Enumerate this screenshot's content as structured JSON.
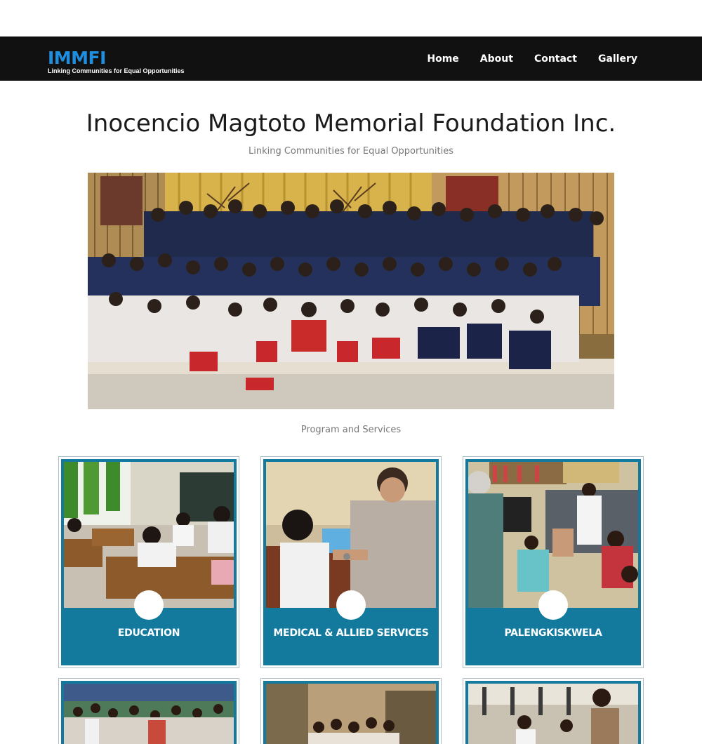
{
  "nav": {
    "brand_name": "IMMFI",
    "brand_tagline": "Linking Communities for Equal Opportunities",
    "links": [
      "Home",
      "About",
      "Contact",
      "Gallery"
    ]
  },
  "hero": {
    "title": "Inocencio Magtoto Memorial Foundation Inc.",
    "subtitle": "Linking Communities for Equal Opportunities"
  },
  "programs": {
    "heading": "Program and Services",
    "cards": [
      {
        "label": "EDUCATION"
      },
      {
        "label": "MEDICAL & ALLIED SERVICES"
      },
      {
        "label": "PALENGKISKWELA"
      }
    ]
  },
  "colors": {
    "navbar": "#111111",
    "brand_blue": "#1e8fe0",
    "card_teal": "#137a9e"
  }
}
